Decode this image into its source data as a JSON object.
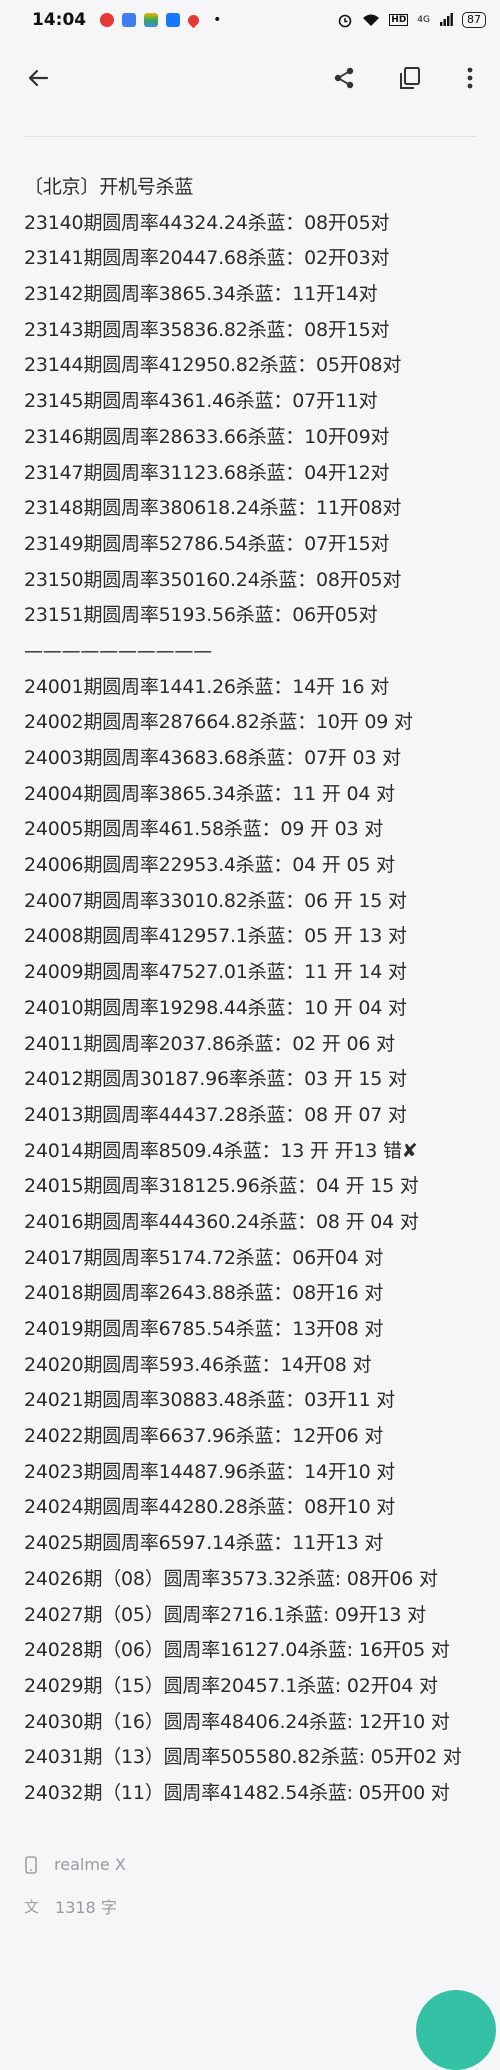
{
  "status_bar": {
    "time": "14:04",
    "notification_icons": [
      {
        "name": "app-red-icon",
        "color": "#e53935"
      },
      {
        "name": "app-blue-icon",
        "color": "#3f7cf0"
      },
      {
        "name": "app-multicolor-icon",
        "color": "#f4b400"
      },
      {
        "name": "app-alipay-icon",
        "color": "#1677ff"
      },
      {
        "name": "app-map-pin-icon",
        "color": "#e53935"
      }
    ],
    "dot": "•",
    "hd": "HD",
    "signal": "4G",
    "battery": "87"
  },
  "toolbar": {
    "back_icon": "arrow-left",
    "share_icon": "share",
    "copy_icon": "copy",
    "more_icon": "more-vertical"
  },
  "note": {
    "lines": [
      "〔北京〕开机号杀蓝",
      "23140期圆周率44324.24杀蓝：08开05对",
      "23141期圆周率20447.68杀蓝：02开03对",
      "23142期圆周率3865.34杀蓝：11开14对",
      "23143期圆周率35836.82杀蓝：08开15对",
      "23144期圆周率412950.82杀蓝：05开08对",
      "23145期圆周率4361.46杀蓝：07开11对",
      "23146期圆周率28633.66杀蓝：10开09对",
      "23147期圆周率31123.68杀蓝：04开12对",
      "23148期圆周率380618.24杀蓝：11开08对",
      "23149期圆周率52786.54杀蓝：07开15对",
      "23150期圆周率350160.24杀蓝：08开05对",
      "23151期圆周率5193.56杀蓝：06开05对",
      "——————————",
      "24001期圆周率1441.26杀蓝：14开 16 对",
      "24002期圆周率287664.82杀蓝：10开 09 对",
      "24003期圆周率43683.68杀蓝：07开 03 对",
      "24004期圆周率3865.34杀蓝：11 开 04 对",
      "24005期圆周率461.58杀蓝：09 开 03 对",
      "24006期圆周率22953.4杀蓝：04 开 05 对",
      "24007期圆周率33010.82杀蓝：06 开 15 对",
      "24008期圆周率412957.1杀蓝：05 开 13 对",
      "24009期圆周率47527.01杀蓝：11 开 14 对",
      "24010期圆周率19298.44杀蓝：10 开 04 对",
      "24011期圆周率2037.86杀蓝：02 开 06 对",
      "24012期圆周30187.96率杀蓝：03 开 15 对",
      "24013期圆周率44437.28杀蓝：08 开 07 对",
      "24014期圆周率8509.4杀蓝：13 开 开13 错✘",
      "24015期圆周率318125.96杀蓝：04 开 15 对",
      "24016期圆周率444360.24杀蓝：08 开 04 对",
      "24017期圆周率5174.72杀蓝：06开04 对",
      "24018期圆周率2643.88杀蓝：08开16 对",
      "24019期圆周率6785.54杀蓝：13开08 对",
      "24020期圆周率593.46杀蓝：14开08 对",
      "24021期圆周率30883.48杀蓝：03开11 对",
      "24022期圆周率6637.96杀蓝：12开06 对",
      "24023期圆周率14487.96杀蓝：14开10 对",
      "24024期圆周率44280.28杀蓝：08开10 对",
      "24025期圆周率6597.14杀蓝：11开13  对",
      "24026期（08）圆周率3573.32杀蓝: 08开06  对",
      "24027期（05）圆周率2716.1杀蓝: 09开13 对",
      "24028期（06）圆周率16127.04杀蓝: 16开05 对",
      "24029期（15）圆周率20457.1杀蓝: 02开04 对",
      "24030期（16）圆周率48406.24杀蓝: 12开10 对",
      "24031期（13）圆周率505580.82杀蓝: 05开02 对",
      "24032期（11）圆周率41482.54杀蓝: 05开00 对"
    ]
  },
  "footer": {
    "device_icon": "phone",
    "device": "realme X",
    "wordcount_icon": "translate",
    "wordcount": "1318 字"
  }
}
